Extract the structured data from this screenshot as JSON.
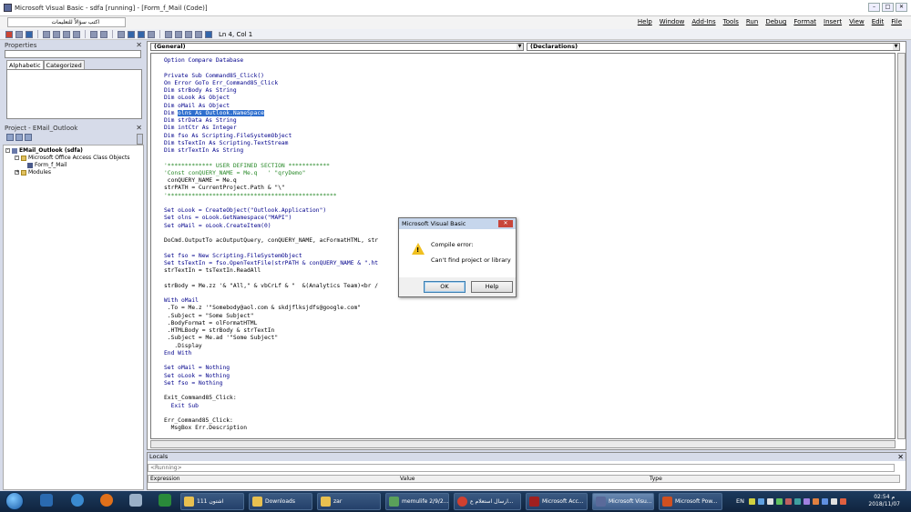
{
  "window": {
    "title": "Microsoft Visual Basic - sdfa [running] - [Form_f_Mail (Code)]",
    "controls": [
      "–",
      "□",
      "✕"
    ]
  },
  "menubar": {
    "question_box": "اكتب سؤالاً للتعليمات",
    "items": [
      "File",
      "Edit",
      "View",
      "Insert",
      "Format",
      "Debug",
      "Run",
      "Tools",
      "Add-Ins",
      "Window",
      "Help"
    ]
  },
  "toolbar": {
    "position": "Ln 4, Col 1"
  },
  "properties": {
    "title": "Properties",
    "tabs": [
      "Alphabetic",
      "Categorized"
    ]
  },
  "project": {
    "title": "Project - EMail_Outlook",
    "tree": [
      {
        "label": "EMail_Outlook (sdfa)"
      },
      {
        "label": "Microsoft Office Access Class Objects"
      },
      {
        "label": "Form_f_Mail"
      },
      {
        "label": "Modules"
      }
    ]
  },
  "code_window": {
    "object_combo": "(General)",
    "procedure_combo": "(Declarations)",
    "lines": [
      {
        "text": "Option Compare Database",
        "kind": "kw"
      },
      {
        "text": "",
        "kind": "plain"
      },
      {
        "text": "Private Sub Command85_Click()",
        "kind": "kw"
      },
      {
        "text": "On Error GoTo Err_Command85_Click",
        "kind": "kw"
      },
      {
        "text": "Dim strBody As String",
        "kind": "kw"
      },
      {
        "text": "Dim oLook As Object",
        "kind": "kw"
      },
      {
        "text": "Dim oMail As Object",
        "kind": "kw"
      },
      {
        "text": "Dim olns As Outlook.NameSpace",
        "kind": "sel"
      },
      {
        "text": "Dim strData As String",
        "kind": "kw"
      },
      {
        "text": "Dim intCtr As Integer",
        "kind": "kw"
      },
      {
        "text": "Dim fso As Scripting.FileSystemObject",
        "kind": "kw"
      },
      {
        "text": "Dim tsTextIn As Scripting.TextStream",
        "kind": "kw"
      },
      {
        "text": "Dim strTextIn As String",
        "kind": "kw"
      },
      {
        "text": "",
        "kind": "plain"
      },
      {
        "text": "'************* USER DEFINED SECTION ************",
        "kind": "cm"
      },
      {
        "text": "'Const conQUERY_NAME = Me.q   ' \"qryDemo\"",
        "kind": "cm"
      },
      {
        "text": " conQUERY_NAME = Me.q",
        "kind": "plain"
      },
      {
        "text": "strPATH = CurrentProject.Path & \"\\\"",
        "kind": "plain"
      },
      {
        "text": "'*************************************************",
        "kind": "cm"
      },
      {
        "text": "",
        "kind": "plain"
      },
      {
        "text": "Set oLook = CreateObject(\"Outlook.Application\")",
        "kind": "kw"
      },
      {
        "text": "Set olns = oLook.GetNamespace(\"MAPI\")",
        "kind": "kw"
      },
      {
        "text": "Set oMail = oLook.CreateItem(0)",
        "kind": "kw"
      },
      {
        "text": "",
        "kind": "plain"
      },
      {
        "text": "DoCmd.OutputTo acOutputQuery, conQUERY_NAME, acFormatHTML, str                           False",
        "kind": "plain"
      },
      {
        "text": "",
        "kind": "plain"
      },
      {
        "text": "Set fso = New Scripting.FileSystemObject",
        "kind": "kw"
      },
      {
        "text": "Set tsTextIn = fso.OpenTextFile(strPATH & conQUERY_NAME & \".ht",
        "kind": "kw"
      },
      {
        "text": "strTextIn = tsTextIn.ReadAll",
        "kind": "plain"
      },
      {
        "text": "",
        "kind": "plain"
      },
      {
        "text": "strBody = Me.zz '& \"All,\" & vbCrLf & \"  &(Analytics Team)<br /",
        "kind": "plain"
      },
      {
        "text": "",
        "kind": "plain"
      },
      {
        "text": "With oMail",
        "kind": "kw"
      },
      {
        "text": " .To = Me.z '\"Somebody@aol.com & skdjflksjdfs@google.com\"",
        "kind": "plain"
      },
      {
        "text": " .Subject = \"Some Subject\"",
        "kind": "plain"
      },
      {
        "text": " .BodyFormat = olFormatHTML",
        "kind": "plain"
      },
      {
        "text": " .HTMLBody = strBody & strTextIn",
        "kind": "plain"
      },
      {
        "text": " .Subject = Me.ad '\"Some Subject\"",
        "kind": "plain"
      },
      {
        "text": "   .Display",
        "kind": "plain"
      },
      {
        "text": "End With",
        "kind": "kw"
      },
      {
        "text": "",
        "kind": "plain"
      },
      {
        "text": "Set oMail = Nothing",
        "kind": "kw"
      },
      {
        "text": "Set oLook = Nothing",
        "kind": "kw"
      },
      {
        "text": "Set fso = Nothing",
        "kind": "kw"
      },
      {
        "text": "",
        "kind": "plain"
      },
      {
        "text": "Exit_Command85_Click:",
        "kind": "plain"
      },
      {
        "text": "  Exit Sub",
        "kind": "kw"
      },
      {
        "text": "",
        "kind": "plain"
      },
      {
        "text": "Err_Command85_Click:",
        "kind": "plain"
      },
      {
        "text": "  MsgBox Err.Description",
        "kind": "plain"
      }
    ]
  },
  "dialog": {
    "title": "Microsoft Visual Basic",
    "close": "✕",
    "message1": "Compile error:",
    "message2": "Can't find project or library",
    "ok_label": "OK",
    "help_label": "Help"
  },
  "locals": {
    "title": "Locals",
    "context": "<Running>",
    "columns": [
      "Expression",
      "Value",
      "Type"
    ]
  },
  "taskbar": {
    "tasks": [
      {
        "label": "اشتون 111"
      },
      {
        "label": "Downloads"
      },
      {
        "label": "zar"
      },
      {
        "label": "memulife 2/9/2..."
      },
      {
        "label": "ارسال استعلام ع..."
      },
      {
        "label": "Microsoft Acc..."
      },
      {
        "label": "Microsoft Visu..."
      },
      {
        "label": "Microsoft Pow..."
      }
    ],
    "lang": "EN",
    "time": "02:54 م",
    "date": "2018/11/07"
  }
}
